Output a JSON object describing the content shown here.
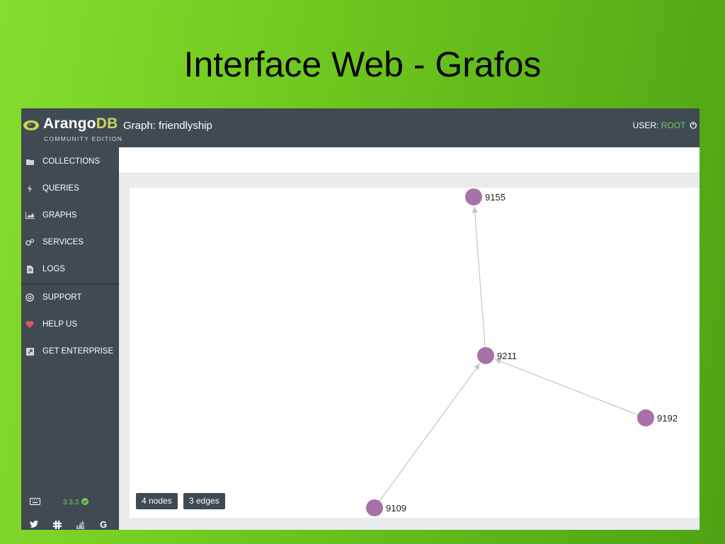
{
  "slide": {
    "title": "Interface Web - Grafos"
  },
  "app": {
    "logo_main": "Arango",
    "logo_accent": "DB",
    "edition": "COMMUNITY EDITION",
    "graph_title": "Graph: friendlyship",
    "user_label": "USER:",
    "user_name": "ROOT",
    "accent_color": "#6ecb63",
    "header_color": "#404a53"
  },
  "sidebar": {
    "items": [
      {
        "label": "COLLECTIONS",
        "icon": "folder-icon"
      },
      {
        "label": "QUERIES",
        "icon": "bolt-icon"
      },
      {
        "label": "GRAPHS",
        "icon": "area-chart-icon"
      },
      {
        "label": "SERVICES",
        "icon": "cogs-icon"
      },
      {
        "label": "LOGS",
        "icon": "file-icon"
      },
      {
        "label": "SUPPORT",
        "icon": "lifebuoy-icon"
      },
      {
        "label": "HELP US",
        "icon": "heart-icon"
      },
      {
        "label": "GET ENTERPRISE",
        "icon": "external-link-icon"
      }
    ],
    "version": "3.3.3",
    "social": [
      "twitter-icon",
      "slack-icon",
      "stackoverflow-icon",
      "google-icon"
    ]
  },
  "graph": {
    "nodes": [
      {
        "id": "9155",
        "label": "9155"
      },
      {
        "id": "9211",
        "label": "9211"
      },
      {
        "id": "9192",
        "label": "9192"
      },
      {
        "id": "9109",
        "label": "9109"
      }
    ],
    "edges": [
      {
        "from": "9211",
        "to": "9155"
      },
      {
        "from": "9192",
        "to": "9211"
      },
      {
        "from": "9109",
        "to": "9211"
      }
    ],
    "node_color": "#a871a7",
    "edge_color": "#c4c4c4",
    "nodes_badge": "4 nodes",
    "edges_badge": "3 edges"
  }
}
